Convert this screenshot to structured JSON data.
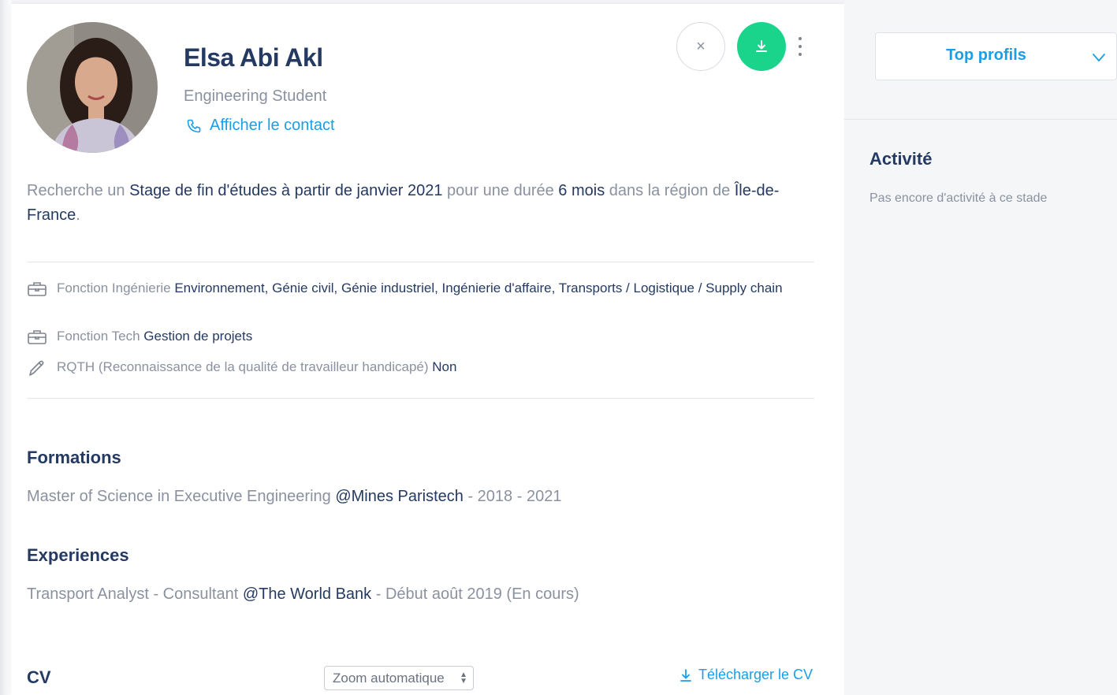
{
  "profile": {
    "name": "Elsa Abi Akl",
    "job_title": "Engineering Student",
    "contact_link": "Afficher le contact"
  },
  "actions": {
    "close_icon": "close-icon",
    "download_icon": "download-icon",
    "more_icon": "more-vertical-icon",
    "download_color": "#1bd48b"
  },
  "search": {
    "prefix": "Recherche un ",
    "contract": "Stage de fin d'études à partir de janvier 2021",
    "duration_prefix": " pour une durée ",
    "duration": "6 mois",
    "region_prefix": " dans la région de ",
    "region": "Île-de-France",
    "suffix": "."
  },
  "criteria": [
    {
      "icon": "briefcase-icon",
      "label": "Fonction Ingénierie ",
      "value": "Environnement, Génie civil, Génie industriel, Ingénierie d'affaire, Transports / Logistique / Supply chain"
    },
    {
      "icon": "briefcase-icon",
      "label": "Fonction Tech ",
      "value": "Gestion de projets"
    },
    {
      "icon": "pencil-icon",
      "label": "RQTH (Reconnaissance de la qualité de travailleur handicapé) ",
      "value": "Non"
    }
  ],
  "formations": {
    "title": "Formations",
    "items": [
      {
        "degree": "Master of Science in Executive Engineering ",
        "school": "@Mines Paristech",
        "dates": " - 2018 - 2021"
      }
    ]
  },
  "experiences": {
    "title": "Experiences",
    "items": [
      {
        "role": "Transport Analyst - Consultant ",
        "company": "@The World Bank",
        "dates": " - Début août 2019 (En cours)"
      }
    ]
  },
  "cv": {
    "title": "CV",
    "zoom_value": "Zoom automatique",
    "download_label": "Télécharger le CV"
  },
  "sidebar": {
    "select_label": "Top profils",
    "activity_title": "Activité",
    "activity_empty": "Pas encore d'activité à ce stade"
  },
  "colors": {
    "accent": "#1a9ee8",
    "heading": "#243a63",
    "muted": "#8a91a0"
  }
}
